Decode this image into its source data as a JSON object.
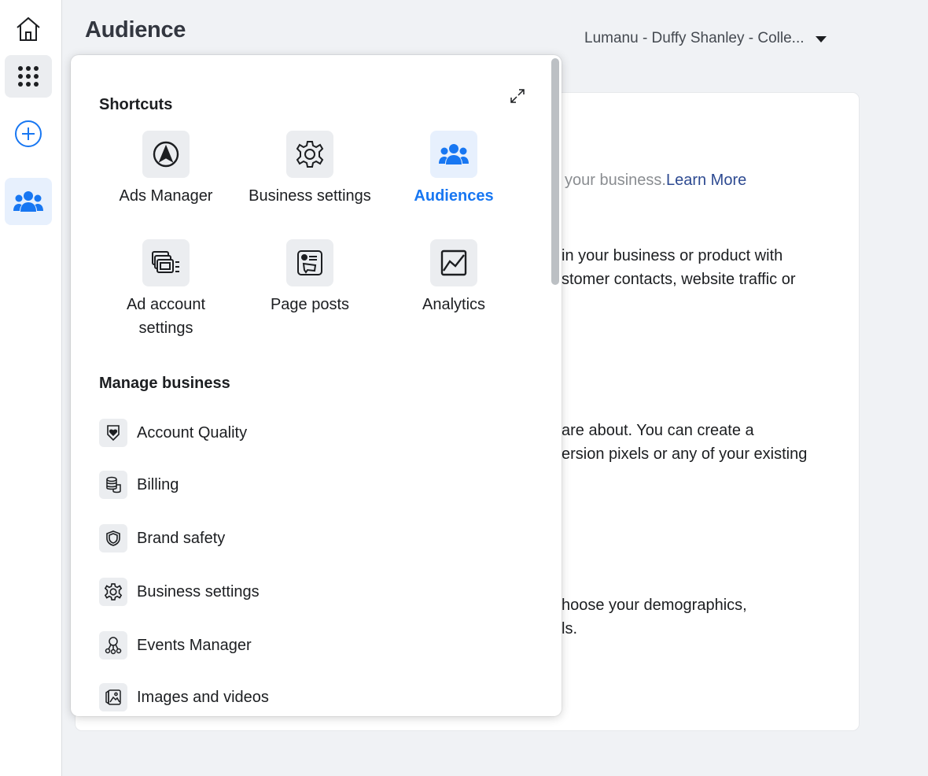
{
  "header": {
    "title": "Audience",
    "account_selector": "Lumanu - Duffy Shanley - Colle..."
  },
  "rail": {
    "items": [
      {
        "icon": "home-icon"
      },
      {
        "icon": "apps-grid-icon"
      },
      {
        "icon": "plus-circle-icon"
      },
      {
        "icon": "audiences-icon",
        "active": true
      }
    ]
  },
  "background": {
    "line1": "your business.",
    "line1_link": "Learn More",
    "line2": "in your business or product with",
    "line3": "stomer contacts, website traffic or",
    "line4": "are about. You can create a",
    "line5": "ersion pixels or any of your existing",
    "line6": "hoose your demographics,",
    "line7": "ls."
  },
  "panel": {
    "shortcuts_title": "Shortcuts",
    "shortcuts": [
      {
        "label": "Ads Manager",
        "icon": "ads-manager-icon"
      },
      {
        "label": "Business settings",
        "icon": "gear-icon"
      },
      {
        "label": "Audiences",
        "icon": "audiences-icon",
        "active": true
      },
      {
        "label": "Ad account settings",
        "icon": "ad-account-settings-icon"
      },
      {
        "label": "Page posts",
        "icon": "page-posts-icon"
      },
      {
        "label": "Analytics",
        "icon": "analytics-icon"
      }
    ],
    "manage_title": "Manage business",
    "manage_items": [
      {
        "label": "Account Quality",
        "icon": "shield-heart-icon"
      },
      {
        "label": "Billing",
        "icon": "coins-icon"
      },
      {
        "label": "Brand safety",
        "icon": "shield-icon"
      },
      {
        "label": "Business settings",
        "icon": "gear-icon"
      },
      {
        "label": "Events Manager",
        "icon": "events-manager-icon"
      },
      {
        "label": "Images and videos",
        "icon": "image-icon"
      }
    ]
  },
  "colors": {
    "accent": "#1877f2",
    "link": "#2d4a91",
    "background": "#f0f2f5"
  }
}
